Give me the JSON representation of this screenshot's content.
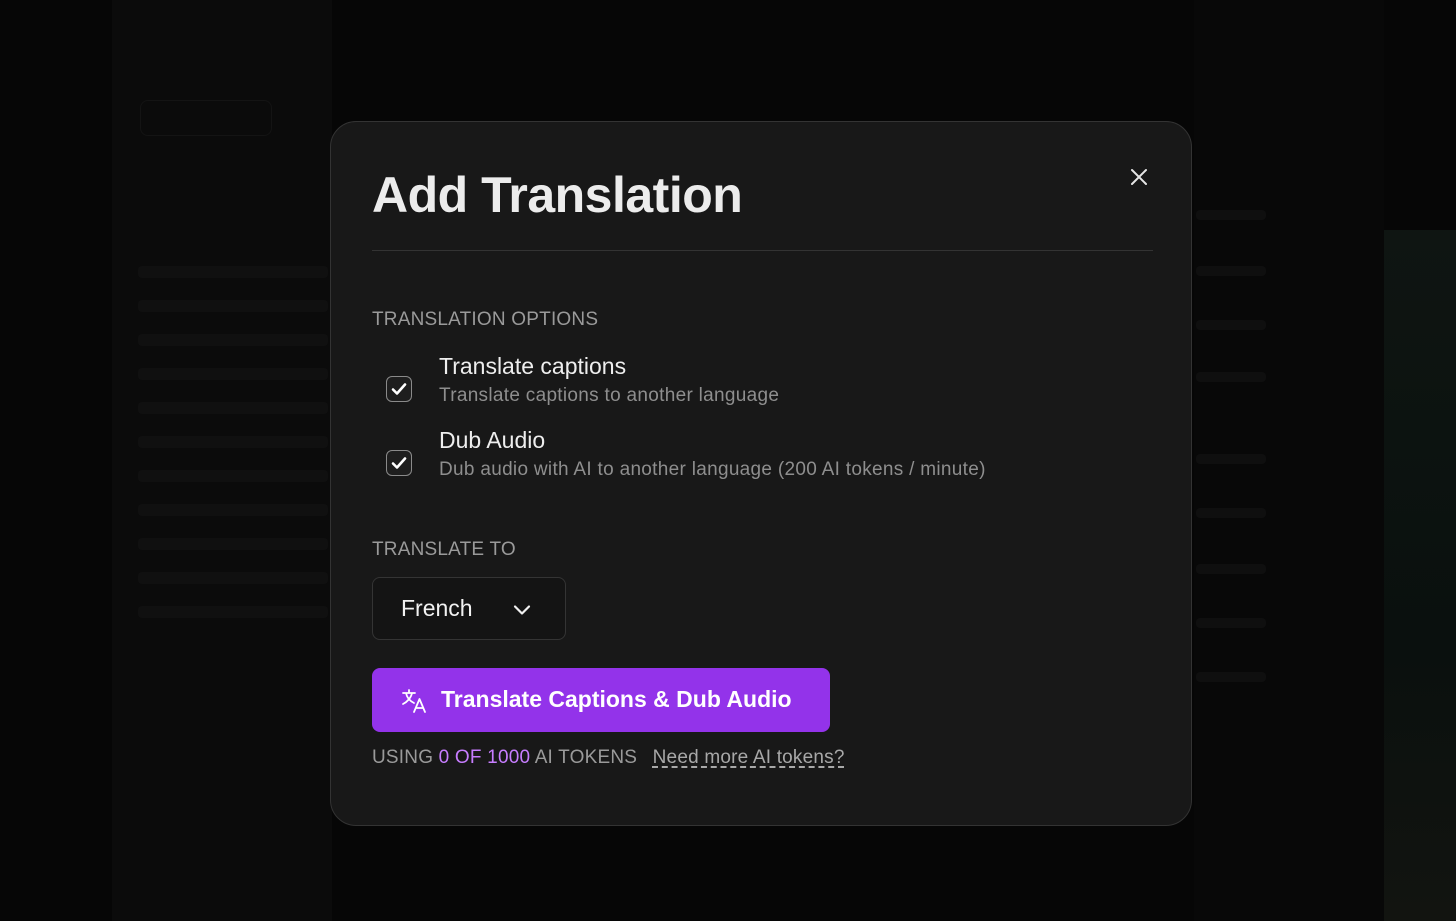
{
  "modal": {
    "title": "Add Translation",
    "close_icon": "close-icon"
  },
  "translation_options": {
    "label": "TRANSLATION OPTIONS",
    "items": [
      {
        "title": "Translate captions",
        "description": "Translate captions to another language",
        "checked": true
      },
      {
        "title": "Dub Audio",
        "description": "Dub audio with AI to another language (200 AI tokens / minute)",
        "checked": true
      }
    ]
  },
  "translate_to": {
    "label": "TRANSLATE TO",
    "selected": "French",
    "icon": "chevron-down-icon"
  },
  "action": {
    "label": "Translate Captions & Dub Audio",
    "icon": "translate-icon",
    "color": "#9333ea"
  },
  "usage": {
    "prefix": "USING",
    "count": "0 OF 1000",
    "suffix": "AI TOKENS",
    "link": "Need more AI tokens?",
    "accent": "#c77dff"
  }
}
